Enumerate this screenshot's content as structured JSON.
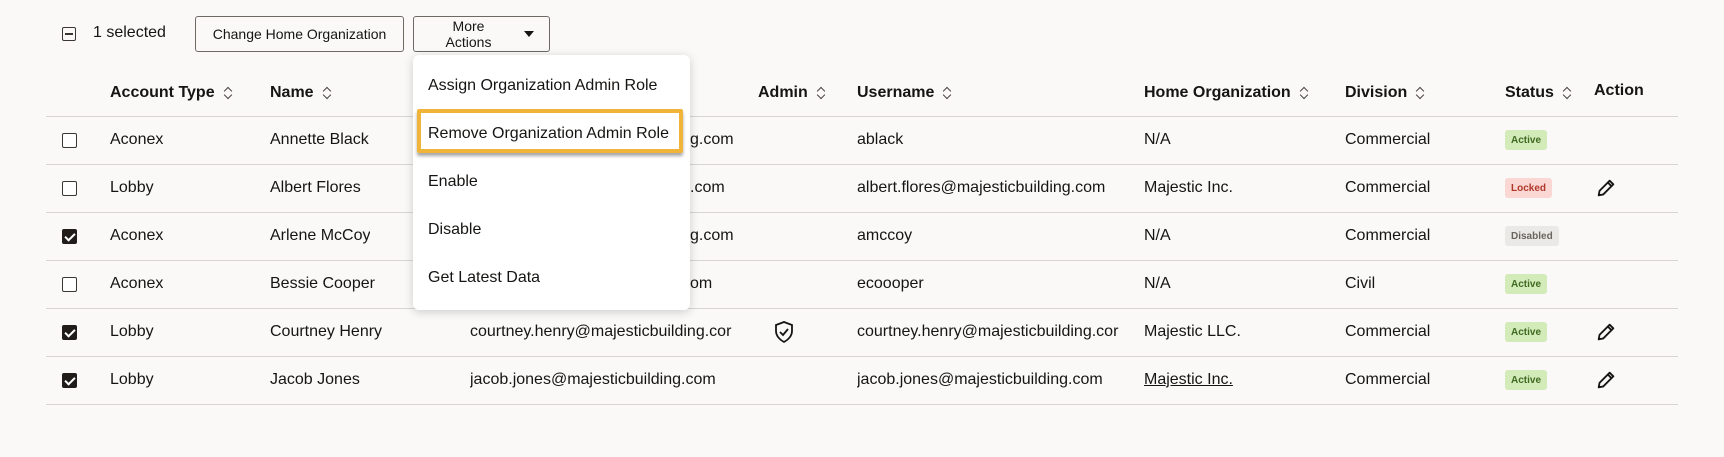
{
  "toolbar": {
    "selected_label": "1 selected",
    "change_home_label": "Change Home Organization",
    "more_actions_label": "More Actions"
  },
  "menu": {
    "items": [
      "Assign Organization Admin Role",
      "Remove Organization Admin Role",
      "Enable",
      "Disable",
      "Get Latest Data"
    ]
  },
  "table": {
    "headers": {
      "account_type": "Account Type",
      "name": "Name",
      "admin": "Admin",
      "username": "Username",
      "home_org": "Home Organization",
      "division": "Division",
      "status": "Status",
      "action": "Action"
    },
    "rows": [
      {
        "checked": false,
        "account_type": "Aconex",
        "name": "Annette Black",
        "email": "g.com",
        "username": "ablack",
        "home_org": "N/A",
        "division": "Commercial",
        "status": "Active",
        "status_kind": "active",
        "editable": false,
        "admin": false
      },
      {
        "checked": false,
        "account_type": "Lobby",
        "name": "Albert Flores",
        "email": ".com",
        "username": "albert.flores@majesticbuilding.com",
        "home_org": "Majestic Inc.",
        "division": "Commercial",
        "status": "Locked",
        "status_kind": "locked",
        "editable": true,
        "admin": false
      },
      {
        "checked": true,
        "account_type": "Aconex",
        "name": "Arlene McCoy",
        "email": "g.com",
        "username": "amccoy",
        "home_org": "N/A",
        "division": "Commercial",
        "status": "Disabled",
        "status_kind": "disabled",
        "editable": false,
        "admin": false
      },
      {
        "checked": false,
        "account_type": "Aconex",
        "name": "Bessie Cooper",
        "email": "om",
        "username": "ecoooper",
        "home_org": "N/A",
        "division": "Civil",
        "status": "Active",
        "status_kind": "active",
        "editable": false,
        "admin": false
      },
      {
        "checked": true,
        "account_type": "Lobby",
        "name": "Courtney Henry",
        "email": "courtney.henry@majesticbuilding.cor",
        "username": "courtney.henry@majesticbuilding.cor",
        "home_org": "Majestic LLC.",
        "division": "Commercial",
        "status": "Active",
        "status_kind": "active",
        "editable": true,
        "admin": true
      },
      {
        "checked": true,
        "account_type": "Lobby",
        "name": "Jacob Jones",
        "email": "jacob.jones@majesticbuilding.com",
        "username": "jacob.jones@majesticbuilding.com",
        "home_org": "Majestic Inc.",
        "division": "Commercial",
        "status": "Active",
        "status_kind": "active",
        "editable": true,
        "admin": false,
        "home_org_link": true
      }
    ]
  }
}
